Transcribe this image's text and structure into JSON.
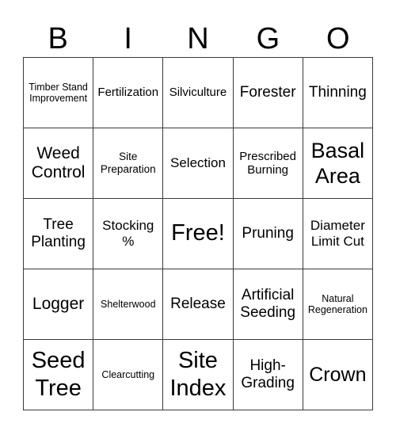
{
  "header": [
    "B",
    "I",
    "N",
    "G",
    "O"
  ],
  "rows": [
    [
      "Timber Stand Improvement",
      "Fertilization",
      "Silviculture",
      "Forester",
      "Thinning"
    ],
    [
      "Weed Control",
      "Site Preparation",
      "Selection",
      "Prescribed Burning",
      "Basal Area"
    ],
    [
      "Tree Planting",
      "Stocking %",
      "Free!",
      "Pruning",
      "Diameter Limit Cut"
    ],
    [
      "Logger",
      "Shelterwood",
      "Release",
      "Artificial Seeding",
      "Natural Regeneration"
    ],
    [
      "Seed Tree",
      "Clearcutting",
      "Site Index",
      "High-Grading",
      "Crown"
    ]
  ]
}
